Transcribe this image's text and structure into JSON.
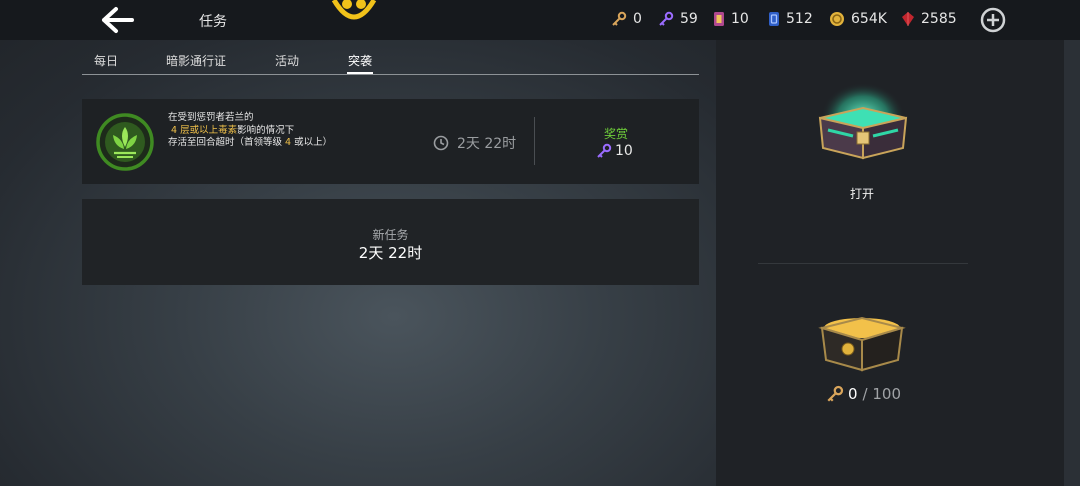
{
  "header": {
    "title": "任务",
    "resources": [
      {
        "icon": "gold-key-icon",
        "value": "0"
      },
      {
        "icon": "purple-key-icon",
        "value": "59"
      },
      {
        "icon": "scroll-ticket-icon",
        "value": "10"
      },
      {
        "icon": "blue-card-icon",
        "value": "512"
      },
      {
        "icon": "gold-coin-icon",
        "value": "654K"
      },
      {
        "icon": "red-gem-icon",
        "value": "2585"
      }
    ]
  },
  "tabs": [
    {
      "label": "每日"
    },
    {
      "label": "暗影通行证"
    },
    {
      "label": "活动"
    },
    {
      "label": "突袭"
    }
  ],
  "active_tab": "突袭",
  "quest": {
    "line1": "在受到惩罚者若兰的",
    "line2_highlight": "4 层或以上毒素",
    "line2_rest": "影响的情况下",
    "line3_a": "存活至回合超时（首领等级 ",
    "line3_num": "4",
    "line3_b": " 或以上）",
    "time_left": "2天 22时",
    "reward_label": "奖赏",
    "reward_value": "10"
  },
  "new_task": {
    "label": "新任务",
    "time": "2天 22时"
  },
  "chest": {
    "open_label": "打开",
    "current": "0",
    "max": "/ 100"
  },
  "colors": {
    "reward_green": "#6fcf3a",
    "highlight_gold": "#f0c14a",
    "purple_key": "#9b6cff",
    "gold_key": "#d9a55b"
  }
}
